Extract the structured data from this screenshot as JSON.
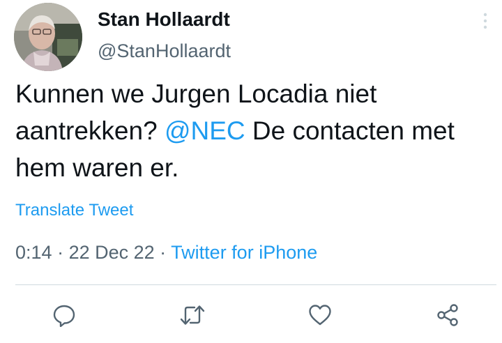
{
  "user": {
    "name": "Stan Hollaardt",
    "handle": "@StanHollaardt"
  },
  "tweet": {
    "text_part1": "Kunnen we Jurgen Locadia niet aantrekken? ",
    "mention": "@NEC",
    "text_part2": " De contacten met hem waren er.",
    "translate_label": "Translate Tweet"
  },
  "meta": {
    "time": "0:14",
    "separator1": " · ",
    "date": "22 Dec 22",
    "separator2": " · ",
    "source": "Twitter for iPhone"
  },
  "actions": [
    {
      "icon": "reply-icon"
    },
    {
      "icon": "retweet-icon"
    },
    {
      "icon": "like-icon"
    },
    {
      "icon": "share-icon"
    }
  ],
  "colors": {
    "accent": "#1d9bf0",
    "text": "#0f1419",
    "secondary": "#536471",
    "divider": "#cfd9de"
  }
}
